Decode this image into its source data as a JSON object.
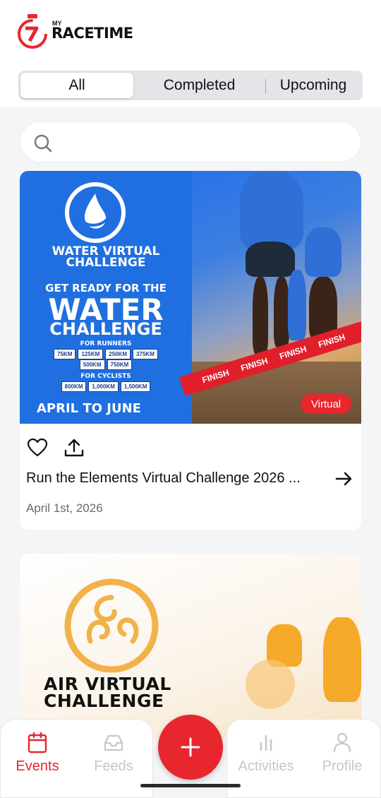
{
  "header": {
    "logo_my": "MY",
    "logo_brand": "RACETIME"
  },
  "tabs": [
    {
      "label": "All",
      "active": true
    },
    {
      "label": "Completed",
      "active": false
    },
    {
      "label": "Upcoming",
      "active": false
    }
  ],
  "search": {
    "placeholder": "",
    "icon": "search-icon"
  },
  "events": [
    {
      "banner": {
        "line1": "WATER VIRTUAL",
        "line2": "CHALLENGE",
        "line3": "GET READY FOR THE",
        "line4": "WATER",
        "line5": "CHALLENGE",
        "runners_label": "FOR RUNNERS",
        "runner_distances_row1": [
          "75KM",
          "125KM",
          "250KM",
          "375KM"
        ],
        "runner_distances_row2": [
          "500KM",
          "750KM"
        ],
        "cyclists_label": "FOR CYCLISTS",
        "cyclist_distances": [
          "800KM",
          "1,000KM",
          "1,500KM"
        ],
        "dates": "APRIL TO JUNE",
        "finish_text": [
          "FINISH",
          "FINISH",
          "FINISH",
          "FINISH"
        ]
      },
      "badge": "Virtual",
      "title": "Run the Elements Virtual Challenge 2026 ...",
      "date": "April 1st, 2026"
    },
    {
      "banner": {
        "line1": "AIR VIRTUAL",
        "line2": "CHALLENGE"
      }
    }
  ],
  "bottom_nav": [
    {
      "label": "Events",
      "icon": "calendar-icon",
      "active": true
    },
    {
      "label": "Feeds",
      "icon": "inbox-icon",
      "active": false
    },
    {
      "label": "Activities",
      "icon": "bar-chart-icon",
      "active": false
    },
    {
      "label": "Profile",
      "icon": "user-icon",
      "active": false
    }
  ],
  "fab": {
    "icon": "plus-icon"
  },
  "colors": {
    "accent": "#e8262e",
    "water_blue": "#1f6fe0",
    "air_orange": "#f2b24a"
  }
}
